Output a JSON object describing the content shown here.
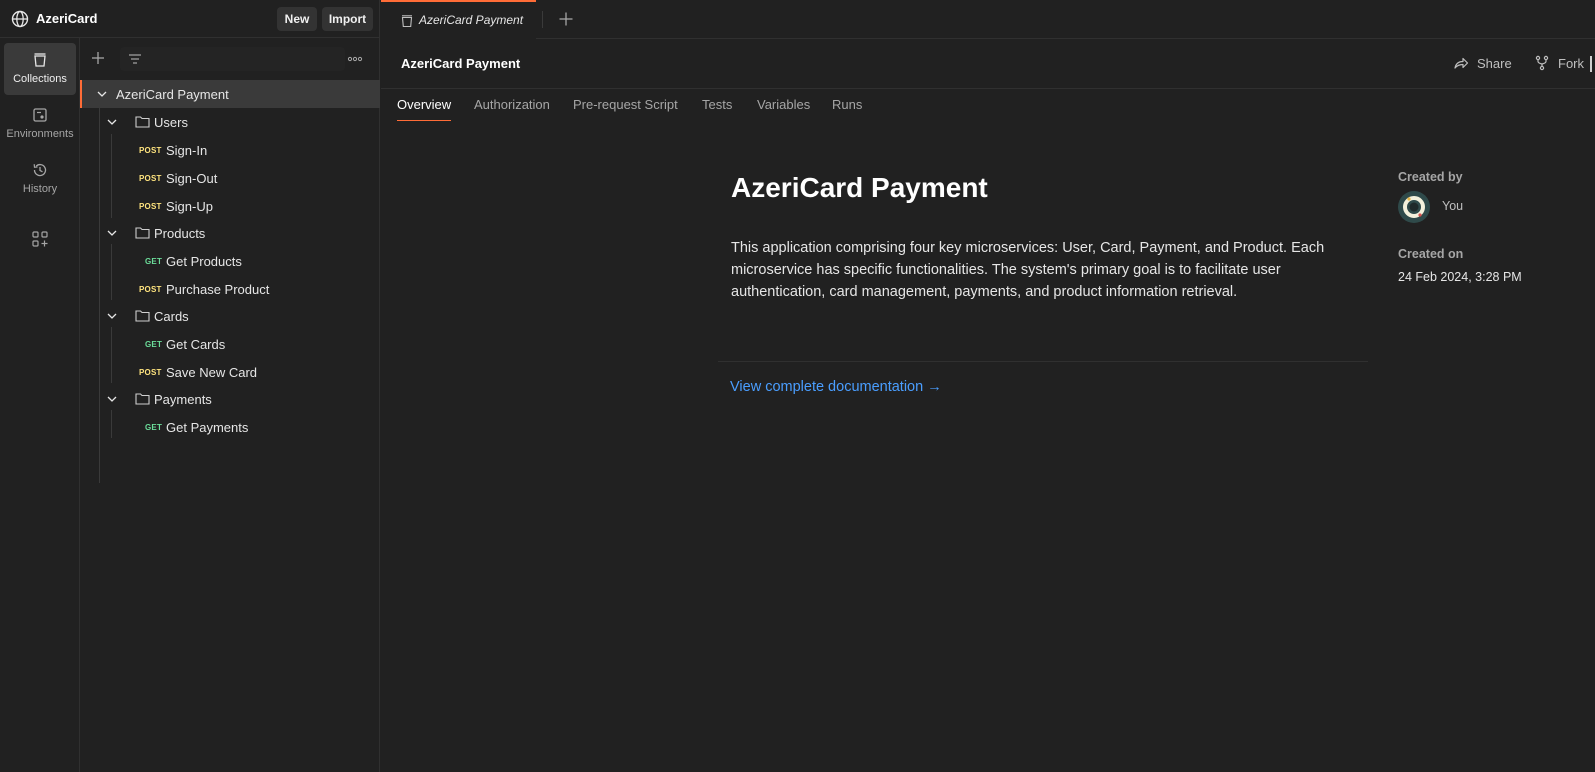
{
  "workspace": {
    "name": "AzeriCard",
    "new_label": "New",
    "import_label": "Import"
  },
  "rail": {
    "items": [
      {
        "label": "Collections",
        "icon": "collections-icon",
        "active": true
      },
      {
        "label": "Environments",
        "icon": "environments-icon",
        "active": false
      },
      {
        "label": "History",
        "icon": "history-icon",
        "active": false
      }
    ],
    "apps_icon": "add-apps-icon"
  },
  "sidebar": {
    "tree": [
      {
        "type": "collection",
        "label": "AzeriCard Payment",
        "expanded": true
      },
      {
        "type": "folder",
        "label": "Users",
        "expanded": true
      },
      {
        "type": "request",
        "method": "POST",
        "label": "Sign-In"
      },
      {
        "type": "request",
        "method": "POST",
        "label": "Sign-Out"
      },
      {
        "type": "request",
        "method": "POST",
        "label": "Sign-Up"
      },
      {
        "type": "folder",
        "label": "Products",
        "expanded": true
      },
      {
        "type": "request",
        "method": "GET",
        "label": "Get Products"
      },
      {
        "type": "request",
        "method": "POST",
        "label": "Purchase Product"
      },
      {
        "type": "folder",
        "label": "Cards",
        "expanded": true
      },
      {
        "type": "request",
        "method": "GET",
        "label": "Get Cards"
      },
      {
        "type": "request",
        "method": "POST",
        "label": "Save New Card"
      },
      {
        "type": "folder",
        "label": "Payments",
        "expanded": true
      },
      {
        "type": "request",
        "method": "GET",
        "label": "Get Payments"
      }
    ]
  },
  "tabs": [
    {
      "label": "AzeriCard Payment",
      "active": true
    }
  ],
  "collection": {
    "title": "AzeriCard Payment",
    "share_label": "Share",
    "fork_label": "Fork"
  },
  "subtabs": [
    "Overview",
    "Authorization",
    "Pre-request Script",
    "Tests",
    "Variables",
    "Runs"
  ],
  "overview": {
    "title": "AzeriCard Payment",
    "description": "This application comprising four key microservices: User, Card, Payment, and Product. Each microservice has specific functionalities. The system's primary goal is to facilitate user authentication, card management, payments, and product information retrieval.",
    "link": "View complete documentation →",
    "created_by_label": "Created by",
    "created_by_value": "You",
    "created_on_label": "Created on",
    "created_on_value": "24 Feb 2024, 3:28 PM"
  },
  "colors": {
    "accent": "#ff6c37",
    "post": "#ffe47e",
    "get": "#6bdd9a",
    "link": "#4a9eff"
  }
}
